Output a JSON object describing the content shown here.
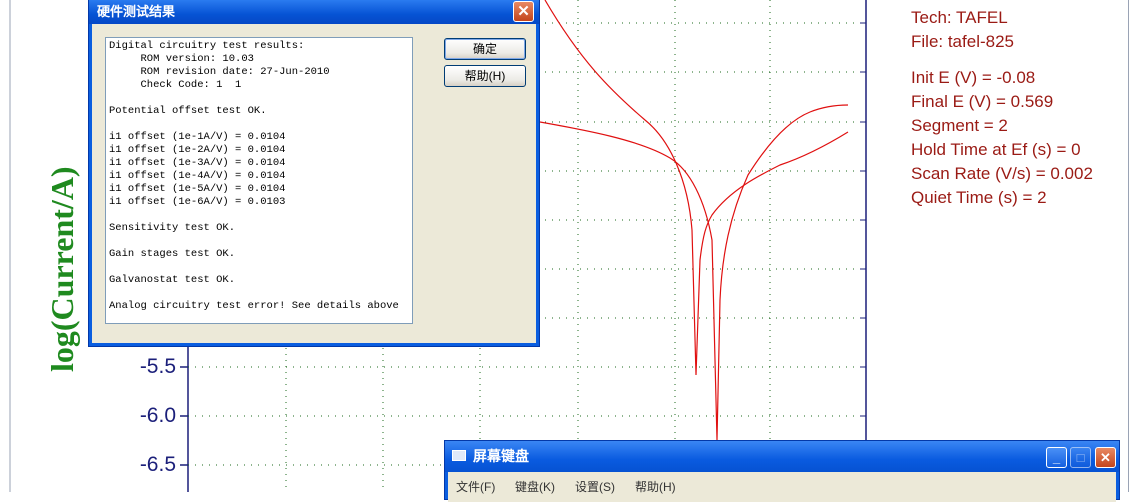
{
  "plot": {
    "y_axis_label": "log(Current/A)",
    "y_ticks": [
      "-5.5",
      "-6.0",
      "-6.5"
    ],
    "info": [
      "Tech: TAFEL",
      "File: tafel-825",
      "Init E (V) = -0.08",
      "Final E (V) = 0.569",
      "Segment = 2",
      "Hold Time at Ef (s) = 0",
      "Scan Rate (V/s) = 0.002",
      "Quiet Time (s) = 2"
    ],
    "curve_color": "#e01010",
    "grid_color": "#1b6a1b"
  },
  "dialog": {
    "title": "硬件测试结果",
    "close_glyph": "✕",
    "ok_label": "确定",
    "help_label": "帮助(H)",
    "lines": [
      "Digital circuitry test results:",
      "     ROM version: 10.03",
      "     ROM revision date: 27-Jun-2010",
      "     Check Code: 1  1",
      "",
      "Potential offset test OK.",
      "",
      "i1 offset (1e-1A/V) = 0.0104",
      "i1 offset (1e-2A/V) = 0.0104",
      "i1 offset (1e-3A/V) = 0.0104",
      "i1 offset (1e-4A/V) = 0.0104",
      "i1 offset (1e-5A/V) = 0.0104",
      "i1 offset (1e-6A/V) = 0.0103",
      "",
      "Sensitivity test OK.",
      "",
      "Gain stages test OK.",
      "",
      "Galvanostat test OK.",
      "",
      "Analog circuitry test error! See details above"
    ]
  },
  "keyboard_window": {
    "title": "屏幕键盘",
    "menu": [
      "文件(F)",
      "键盘(K)",
      "设置(S)",
      "帮助(H)"
    ],
    "min_glyph": "_",
    "max_glyph": "□",
    "close_glyph": "✕"
  }
}
